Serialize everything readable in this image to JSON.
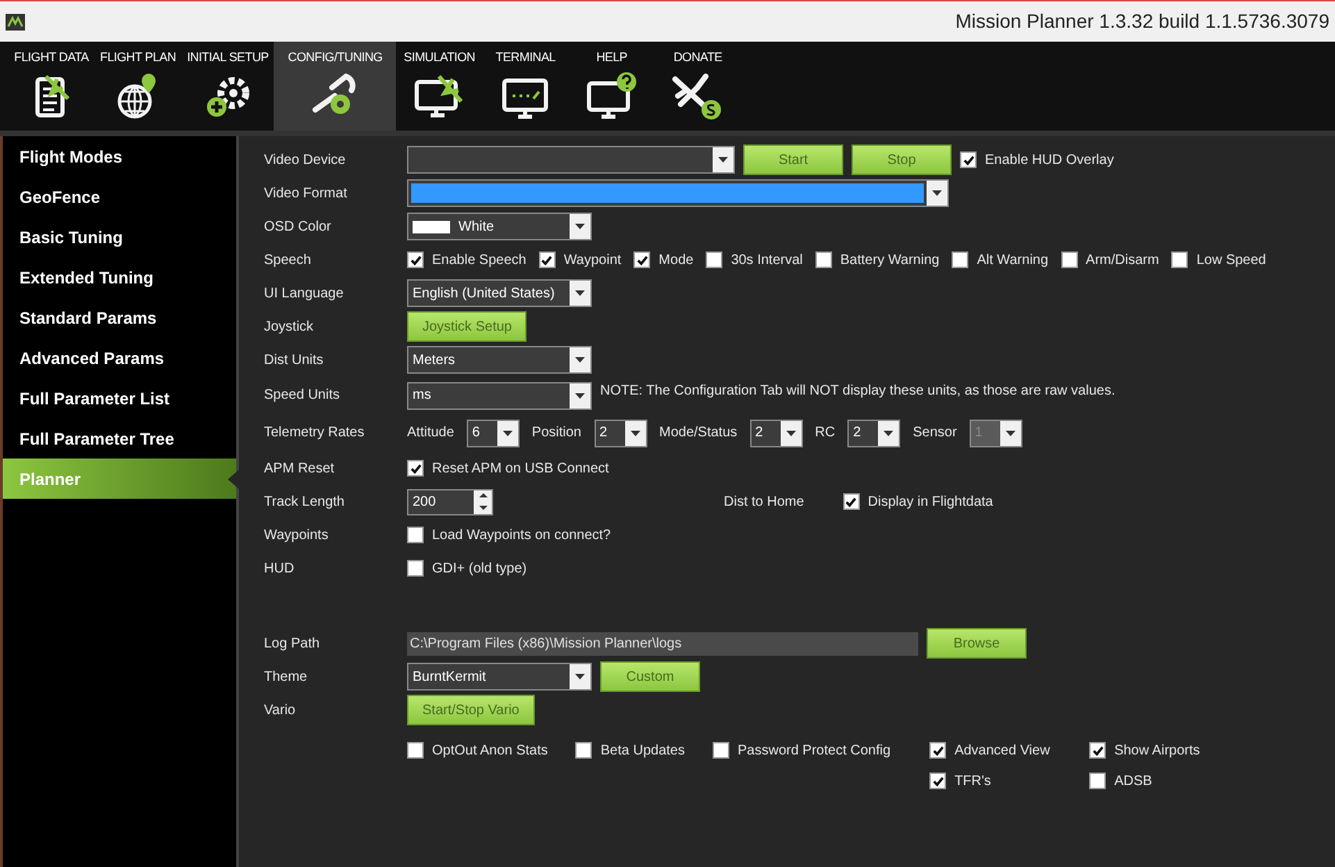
{
  "window": {
    "title": "Mission Planner 1.3.32 build 1.1.5736.3079"
  },
  "toolbar": [
    {
      "label": "FLIGHT DATA",
      "kind": "data",
      "selected": false
    },
    {
      "label": "FLIGHT PLAN",
      "kind": "plan",
      "selected": false
    },
    {
      "label": "INITIAL SETUP",
      "kind": "setup",
      "selected": false
    },
    {
      "label": "CONFIG/TUNING",
      "kind": "config",
      "selected": true
    },
    {
      "label": "SIMULATION",
      "kind": "simulation",
      "selected": false
    },
    {
      "label": "TERMINAL",
      "kind": "terminal",
      "selected": false
    },
    {
      "label": "HELP",
      "kind": "help",
      "selected": false
    },
    {
      "label": "DONATE",
      "kind": "donate",
      "selected": false
    }
  ],
  "sidebar": [
    {
      "label": "Flight Modes",
      "selected": false
    },
    {
      "label": "GeoFence",
      "selected": false
    },
    {
      "label": "Basic Tuning",
      "selected": false
    },
    {
      "label": "Extended Tuning",
      "selected": false
    },
    {
      "label": "Standard Params",
      "selected": false
    },
    {
      "label": "Advanced Params",
      "selected": false
    },
    {
      "label": "Full Parameter List",
      "selected": false
    },
    {
      "label": "Full Parameter Tree",
      "selected": false
    },
    {
      "label": "Planner",
      "selected": true
    }
  ],
  "settings": [
    {
      "label": "Video Device",
      "controls": [
        {
          "kind": "combo_wide"
        },
        {
          "kind": "button",
          "label": "Start"
        },
        {
          "kind": "button",
          "label": "Stop"
        },
        {
          "kind": "checkbox",
          "label": "Enable HUD Overlay",
          "checked": true
        }
      ]
    },
    {
      "label": "Video Format",
      "controls": [
        {
          "kind": "combo_full"
        }
      ]
    },
    {
      "label": "OSD Color",
      "controls": [
        {
          "kind": "combo_color",
          "value": "White",
          "color": "#ffffff"
        }
      ]
    },
    {
      "label": "Speech",
      "controls": [
        {
          "kind": "checkbox",
          "label": "Enable Speech",
          "checked": true
        },
        {
          "kind": "checkbox",
          "label": "Waypoint",
          "checked": true
        },
        {
          "kind": "checkbox",
          "label": "Mode",
          "checked": true
        },
        {
          "kind": "checkbox",
          "label": "30s Interval",
          "checked": false
        },
        {
          "kind": "checkbox",
          "label": "Battery Warning",
          "checked": false
        },
        {
          "kind": "checkbox",
          "label": "Alt Warning",
          "checked": false
        },
        {
          "kind": "checkbox",
          "label": "Arm/Disarm",
          "checked": false
        },
        {
          "kind": "checkbox",
          "label": "Low Speed",
          "checked": false
        }
      ]
    },
    {
      "label": "UI Language",
      "controls": [
        {
          "kind": "combo",
          "value": "English (United States)"
        }
      ]
    },
    {
      "label": "Joystick",
      "controls": [
        {
          "kind": "button_wide",
          "label": "Joystick Setup"
        }
      ]
    },
    {
      "label": "Dist Units",
      "controls": [
        {
          "kind": "combo",
          "value": "Meters"
        }
      ]
    },
    {
      "label": "Speed Units",
      "controls": [
        {
          "kind": "combo",
          "value": "ms"
        },
        {
          "kind": "note",
          "text": "NOTE: The Configuration Tab will NOT display these units, as those are raw values."
        }
      ]
    },
    {
      "label": "Telemetry Rates",
      "controls": [
        {
          "kind": "inline_label",
          "text": "Attitude"
        },
        {
          "kind": "combo_small",
          "value": "6",
          "disabled": false
        },
        {
          "kind": "inline_label",
          "text": "Position"
        },
        {
          "kind": "combo_small",
          "value": "2",
          "disabled": false
        },
        {
          "kind": "inline_label",
          "text": "Mode/Status"
        },
        {
          "kind": "combo_small",
          "value": "2",
          "disabled": false
        },
        {
          "kind": "inline_label",
          "text": "RC"
        },
        {
          "kind": "combo_small",
          "value": "2",
          "disabled": false
        },
        {
          "kind": "inline_label",
          "text": "Sensor"
        },
        {
          "kind": "combo_small",
          "value": "1",
          "disabled": true
        }
      ]
    },
    {
      "label": "APM Reset",
      "controls": [
        {
          "kind": "checkbox",
          "label": "Reset APM on USB Connect",
          "checked": true
        }
      ]
    },
    {
      "label": "Track Length",
      "controls": [
        {
          "kind": "spinner",
          "value": "200"
        },
        {
          "kind": "far_label",
          "text": "Dist to Home"
        },
        {
          "kind": "checkbox",
          "label": "Display in Flightdata",
          "checked": true
        }
      ]
    },
    {
      "label": "Waypoints",
      "controls": [
        {
          "kind": "checkbox",
          "label": "Load Waypoints on connect?",
          "checked": false
        }
      ]
    },
    {
      "label": "HUD",
      "controls": [
        {
          "kind": "checkbox",
          "label": "GDI+ (old type)",
          "checked": false
        }
      ]
    },
    {
      "label": "Log Path",
      "controls": [
        {
          "kind": "path",
          "value": "C:\\Program Files (x86)\\Mission Planner\\logs"
        },
        {
          "kind": "button",
          "label": "Browse"
        }
      ]
    },
    {
      "label": "Theme",
      "controls": [
        {
          "kind": "combo",
          "value": "BurntKermit"
        },
        {
          "kind": "button",
          "label": "Custom"
        }
      ]
    },
    {
      "label": "Vario",
      "controls": [
        {
          "kind": "button_wide",
          "label": "Start/Stop Vario"
        }
      ]
    }
  ],
  "privacy_options": [
    {
      "label": "OptOut Anon Stats",
      "checked": false
    },
    {
      "label": "Beta Updates",
      "checked": false
    },
    {
      "label": "Password Protect Config",
      "checked": false
    }
  ],
  "view_options": [
    {
      "label": "Advanced View",
      "checked": true
    },
    {
      "label": "Show Airports",
      "checked": true
    },
    {
      "label": "TFR's",
      "checked": true
    },
    {
      "label": "ADSB",
      "checked": false
    }
  ]
}
